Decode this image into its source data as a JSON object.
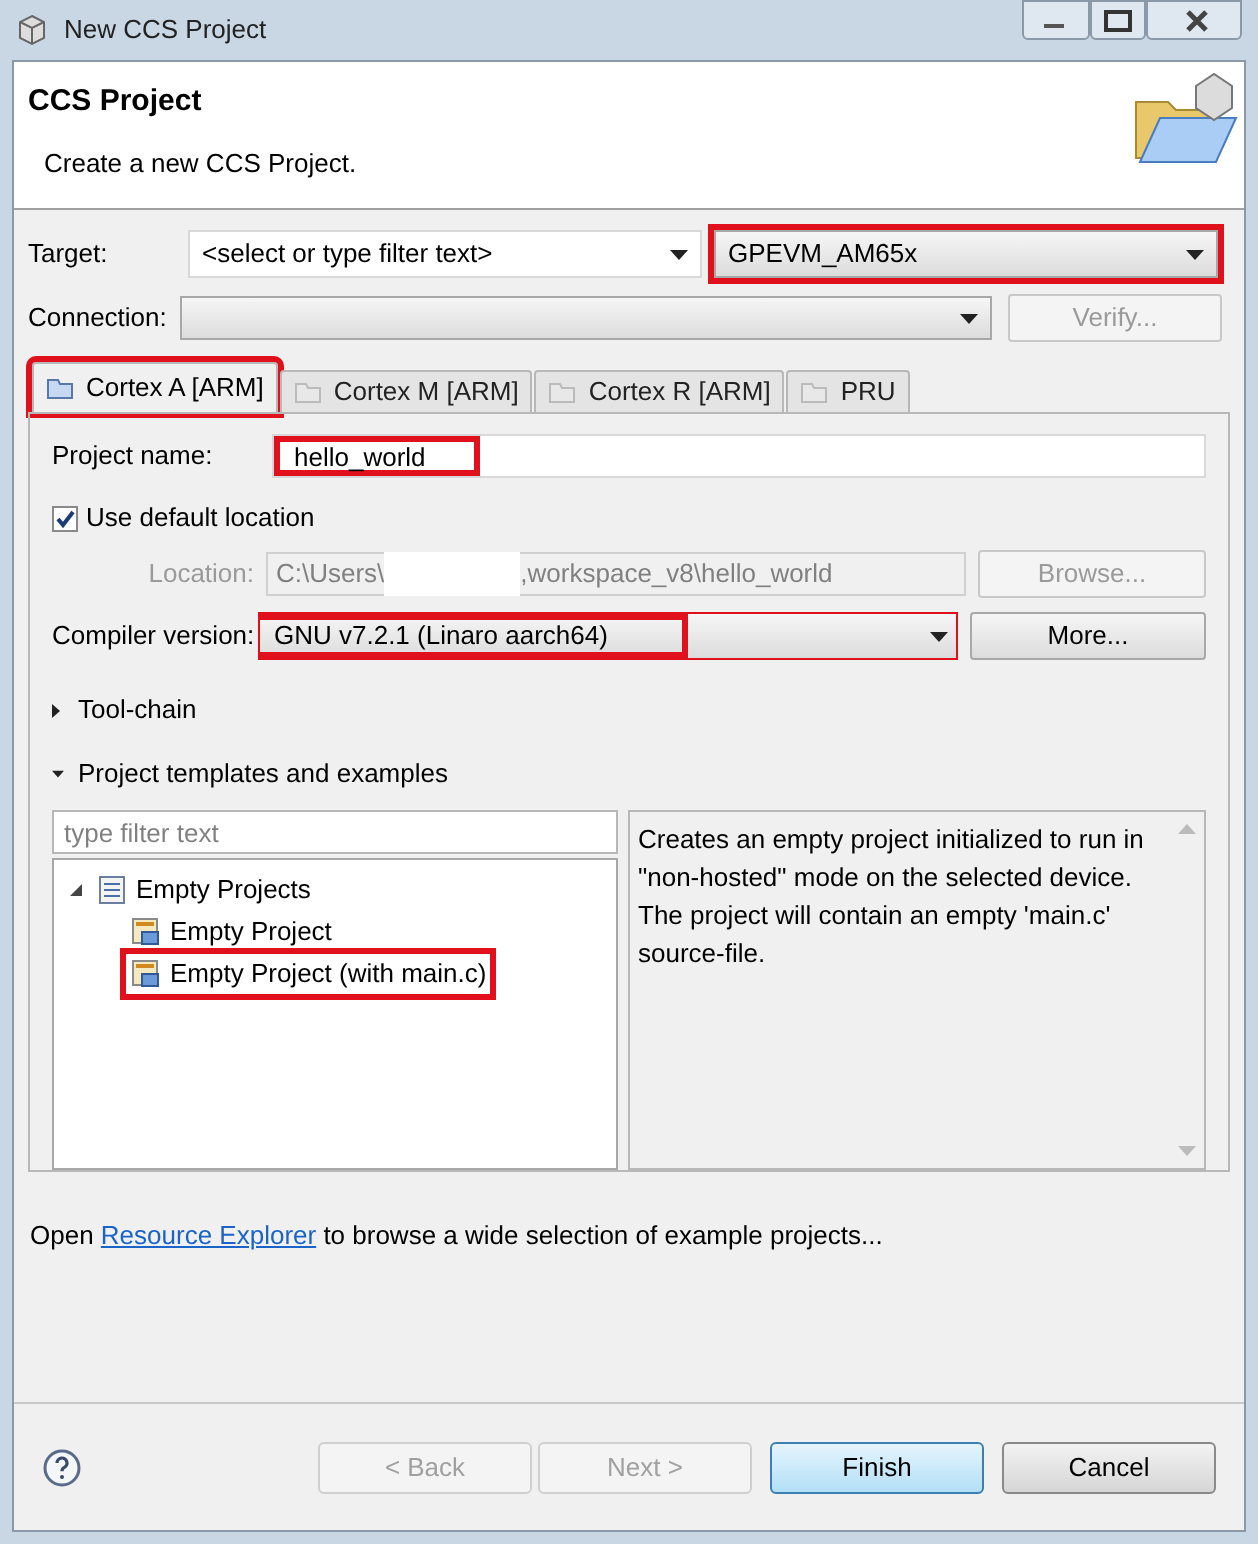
{
  "window": {
    "title": "New CCS Project"
  },
  "header": {
    "title": "CCS Project",
    "subtitle": "Create a new CCS Project."
  },
  "target": {
    "label": "Target:",
    "filter_placeholder": "<select or type filter text>",
    "value": "GPEVM_AM65x",
    "highlighted": true
  },
  "connection": {
    "label": "Connection:",
    "button": "Verify...",
    "button_disabled": true
  },
  "tabs": [
    {
      "label": "Cortex A [ARM]",
      "selected": true,
      "highlighted": true
    },
    {
      "label": "Cortex M [ARM]",
      "selected": false,
      "highlighted": false
    },
    {
      "label": "Cortex R [ARM]",
      "selected": false,
      "highlighted": false
    },
    {
      "label": "PRU",
      "selected": false,
      "highlighted": false
    }
  ],
  "project_name": {
    "label": "Project name:",
    "value": "hello_world",
    "highlighted": true
  },
  "use_default_location": {
    "label": "Use default location",
    "checked": true
  },
  "location": {
    "label": "Location:",
    "value_start": "C:\\Users\\",
    "value_end": ",workspace_v8\\hello_world",
    "disabled": true,
    "button": "Browse..."
  },
  "compiler": {
    "label": "Compiler version:",
    "value": "GNU v7.2.1 (Linaro aarch64)",
    "highlighted": true,
    "button": "More..."
  },
  "sections": [
    {
      "label": "Tool-chain",
      "expanded": false
    },
    {
      "label": "Project templates and examples",
      "expanded": true
    }
  ],
  "templates": {
    "filter_placeholder": "type filter text",
    "tree": [
      {
        "label": "Empty Projects",
        "kind": "folder",
        "expanded": true,
        "highlighted": false,
        "children": [
          {
            "label": "Empty Project",
            "kind": "template",
            "highlighted": false
          },
          {
            "label": "Empty Project (with main.c)",
            "kind": "template",
            "highlighted": true
          }
        ]
      }
    ],
    "description": "Creates an empty project initialized to run in \"non-hosted\" mode on the selected device. The project will contain an empty 'main.c' source-file."
  },
  "footer_note": {
    "before": "Open ",
    "link": "Resource Explorer",
    "after": " to browse a wide selection of example projects..."
  },
  "buttons": [
    {
      "label": "< Back",
      "disabled": true,
      "default": false
    },
    {
      "label": "Next >",
      "disabled": true,
      "default": false
    },
    {
      "label": "Finish",
      "disabled": false,
      "default": true
    },
    {
      "label": "Cancel",
      "disabled": false,
      "default": false
    }
  ]
}
